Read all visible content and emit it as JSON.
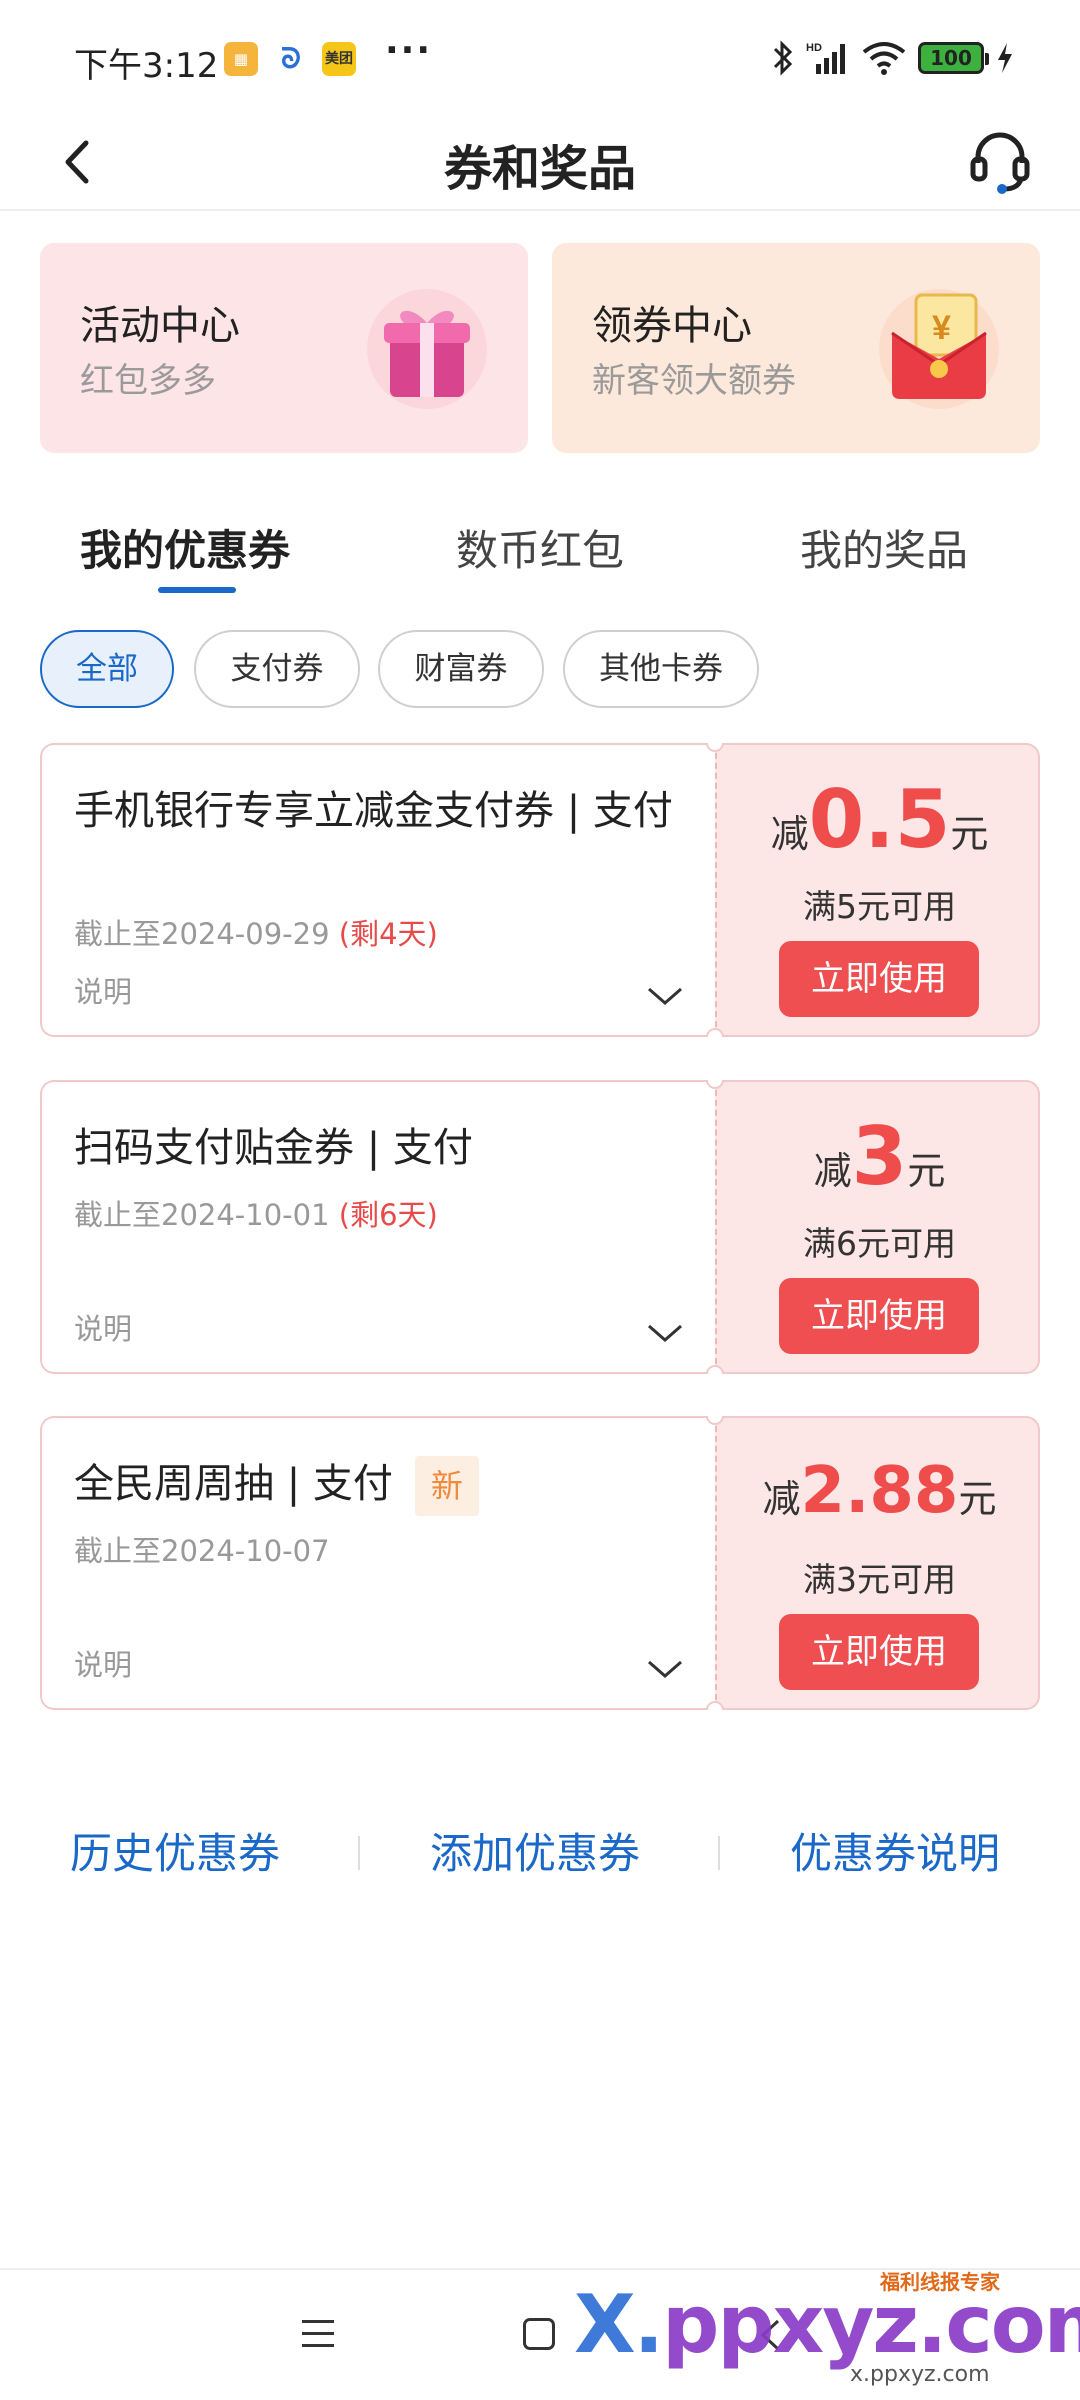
{
  "status_bar": {
    "time": "下午3:12",
    "app_badge_meituan": "美团",
    "battery": "100"
  },
  "header": {
    "title": "券和奖品"
  },
  "promos": [
    {
      "title": "活动中心",
      "subtitle": "红包多多"
    },
    {
      "title": "领券中心",
      "subtitle": "新客领大额券"
    }
  ],
  "tabs": [
    {
      "label": "我的优惠券",
      "active": true
    },
    {
      "label": "数币红包",
      "active": false
    },
    {
      "label": "我的奖品",
      "active": false
    }
  ],
  "filters": [
    {
      "label": "全部",
      "active": true
    },
    {
      "label": "支付券",
      "active": false
    },
    {
      "label": "财富券",
      "active": false
    },
    {
      "label": "其他卡券",
      "active": false
    }
  ],
  "coupons": [
    {
      "title": "手机银行专享立减金支付券 | 支付",
      "expiry": "截止至2024-09-29",
      "remaining": "(剩4天)",
      "desc": "说明",
      "prefix": "减",
      "amount": "0.5",
      "unit": "元",
      "condition": "满5元可用",
      "button": "立即使用"
    },
    {
      "title": "扫码支付贴金券 | 支付",
      "expiry": "截止至2024-10-01",
      "remaining": "(剩6天)",
      "desc": "说明",
      "prefix": "减",
      "amount": "3",
      "unit": "元",
      "condition": "满6元可用",
      "button": "立即使用"
    },
    {
      "title": "全民周周抽 | 支付",
      "badge": "新",
      "expiry": "截止至2024-10-07",
      "desc": "说明",
      "prefix": "减",
      "amount": "2.88",
      "unit": "元",
      "condition": "满3元可用",
      "button": "立即使用"
    }
  ],
  "bottom_links": [
    "历史优惠券",
    "添加优惠券",
    "优惠券说明"
  ],
  "watermark": {
    "brand": "X.ppxyz.com",
    "brand_x": "X.",
    "brand_rest": "ppxyz.com",
    "tag": "福利线报专家",
    "url": "x.ppxyz.com"
  },
  "colors": {
    "accent_blue": "#1a68c8",
    "coupon_red": "#ef4c4c",
    "coupon_bg": "#fde6e6"
  }
}
